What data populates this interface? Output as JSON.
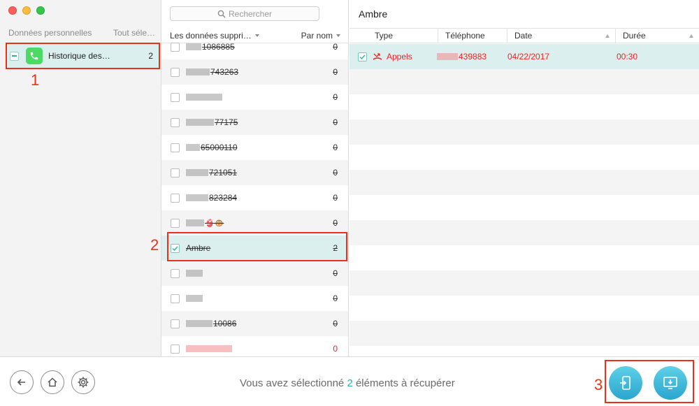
{
  "left": {
    "header_title": "Données personnelles",
    "select_all": "Tout séle…",
    "history_label": "Historique des…",
    "history_count": "2"
  },
  "middle": {
    "search_placeholder": "Rechercher",
    "col_name": "Les données suppri…",
    "sort_label": "Par nom",
    "rows": [
      {
        "name": "1086885",
        "count": "0"
      },
      {
        "name": "743263",
        "count": "0"
      },
      {
        "name": "",
        "count": "0"
      },
      {
        "name": "77175",
        "count": "0"
      },
      {
        "name": "65000110",
        "count": "0"
      },
      {
        "name": "721051",
        "count": "0"
      },
      {
        "name": "823284",
        "count": "0"
      },
      {
        "name": "👙🐵",
        "count": "0"
      },
      {
        "name": "Ambre",
        "count": "2"
      },
      {
        "name": "",
        "count": "0"
      },
      {
        "name": "",
        "count": "0"
      },
      {
        "name": "10086",
        "count": "0"
      },
      {
        "name": "",
        "count": "0"
      }
    ]
  },
  "right": {
    "contact_name": "Ambre",
    "columns": [
      "Type",
      "Téléphone",
      "Date",
      "Durée"
    ],
    "record": {
      "type": "Appels",
      "phone": "439883",
      "date": "04/22/2017",
      "duration": "00:30"
    }
  },
  "bottom": {
    "status_prefix": "Vous avez sélectionné",
    "status_count": "2",
    "status_suffix": "éléments à récupérer"
  },
  "annotations": [
    "1",
    "2",
    "3"
  ],
  "colors": {
    "accent": "#2bb0a6",
    "highlight_row": "#dcefef",
    "annotation_red": "#e8331a",
    "deleted_red": "#e22"
  },
  "icons": [
    "back-icon",
    "home-icon",
    "settings-icon",
    "phone-icon",
    "search-icon",
    "to-device-icon",
    "to-computer-icon",
    "missed-call-icon",
    "check-icon"
  ]
}
